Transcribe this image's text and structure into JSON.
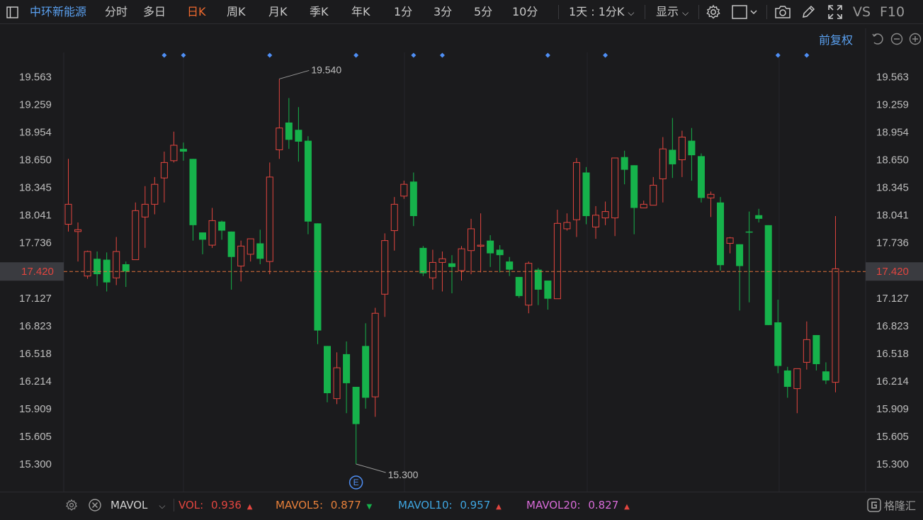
{
  "toolbar": {
    "stock_name": "中环新能源",
    "tabs": [
      "分时",
      "多日",
      "日K",
      "周K",
      "月K",
      "季K",
      "年K",
      "1分",
      "3分",
      "5分",
      "10分"
    ],
    "active_tab": "日K",
    "period_select": "1天 : 1分K",
    "display_menu": "显示",
    "vs_label": "VS",
    "f10_label": "F10"
  },
  "adjust": {
    "label": "前复权"
  },
  "axis": {
    "ticks": [
      "19.563",
      "19.259",
      "18.954",
      "18.650",
      "18.345",
      "18.041",
      "17.736",
      "17.420",
      "17.127",
      "16.823",
      "16.518",
      "16.214",
      "15.909",
      "15.605",
      "15.300"
    ],
    "current_price": "17.420"
  },
  "annotations": {
    "high": "19.540",
    "low": "15.300",
    "event_badge": "E"
  },
  "indicator": {
    "name": "MAVOL",
    "vol_label": "VOL:",
    "vol_value": "0.936",
    "mavol5_label": "MAVOL5:",
    "mavol5_value": "0.877",
    "mavol10_label": "MAVOL10:",
    "mavol10_value": "0.957",
    "mavol20_label": "MAVOL20:",
    "mavol20_value": "0.827"
  },
  "brand": {
    "name": "格隆汇"
  },
  "colors": {
    "up": "#e2453f",
    "down": "#16b24b",
    "active_tab": "#f06a2e",
    "accent_blue": "#5aa0f0",
    "marker": "#4f8ff5",
    "price_line": "#e0733a",
    "mavol20": "#d86bd8"
  },
  "chart_data": {
    "type": "candlestick",
    "y_range": [
      15.15,
      19.75
    ],
    "candles": [
      {
        "o": 17.94,
        "c": 18.16,
        "h": 18.66,
        "l": 17.86
      },
      {
        "o": 17.86,
        "c": 17.88,
        "h": 17.96,
        "l": 17.53
      },
      {
        "o": 17.37,
        "c": 17.64,
        "h": 17.65,
        "l": 17.34
      },
      {
        "o": 17.56,
        "c": 17.39,
        "h": 17.64,
        "l": 17.26
      },
      {
        "o": 17.55,
        "c": 17.3,
        "h": 17.63,
        "l": 17.2
      },
      {
        "o": 17.35,
        "c": 17.64,
        "h": 17.8,
        "l": 17.27
      },
      {
        "o": 17.5,
        "c": 17.42,
        "h": 17.53,
        "l": 17.25
      },
      {
        "o": 17.55,
        "c": 18.09,
        "h": 18.18,
        "l": 17.55
      },
      {
        "o": 18.02,
        "c": 18.16,
        "h": 18.36,
        "l": 17.68
      },
      {
        "o": 18.16,
        "c": 18.38,
        "h": 18.46,
        "l": 18.05
      },
      {
        "o": 18.45,
        "c": 18.62,
        "h": 18.74,
        "l": 18.18
      },
      {
        "o": 18.64,
        "c": 18.81,
        "h": 18.96,
        "l": 18.62
      },
      {
        "o": 18.77,
        "c": 18.74,
        "h": 18.84,
        "l": 18.64
      },
      {
        "o": 18.66,
        "c": 17.93,
        "h": 18.66,
        "l": 17.76
      },
      {
        "o": 17.85,
        "c": 17.77,
        "h": 17.85,
        "l": 17.61
      },
      {
        "o": 17.71,
        "c": 17.98,
        "h": 18.12,
        "l": 17.68
      },
      {
        "o": 17.97,
        "c": 17.87,
        "h": 17.98,
        "l": 17.77
      },
      {
        "o": 17.86,
        "c": 17.58,
        "h": 17.86,
        "l": 17.22
      },
      {
        "o": 17.48,
        "c": 17.7,
        "h": 17.76,
        "l": 17.31
      },
      {
        "o": 17.61,
        "c": 17.78,
        "h": 17.78,
        "l": 17.53
      },
      {
        "o": 17.73,
        "c": 17.56,
        "h": 17.88,
        "l": 17.5
      },
      {
        "o": 17.53,
        "c": 18.46,
        "h": 18.62,
        "l": 17.39
      },
      {
        "o": 18.76,
        "c": 19.0,
        "h": 19.54,
        "l": 18.66
      },
      {
        "o": 19.06,
        "c": 18.87,
        "h": 19.33,
        "l": 18.77
      },
      {
        "o": 18.98,
        "c": 18.85,
        "h": 19.23,
        "l": 18.63
      },
      {
        "o": 18.86,
        "c": 17.97,
        "h": 18.91,
        "l": 17.83
      },
      {
        "o": 17.95,
        "c": 16.77,
        "h": 17.95,
        "l": 16.62
      },
      {
        "o": 16.6,
        "c": 16.08,
        "h": 16.6,
        "l": 15.98
      },
      {
        "o": 16.02,
        "c": 16.36,
        "h": 16.53,
        "l": 15.96
      },
      {
        "o": 16.51,
        "c": 16.19,
        "h": 16.65,
        "l": 15.86
      },
      {
        "o": 16.15,
        "c": 15.74,
        "h": 16.15,
        "l": 15.3
      },
      {
        "o": 16.6,
        "c": 16.03,
        "h": 16.85,
        "l": 15.91
      },
      {
        "o": 16.04,
        "c": 16.96,
        "h": 17.02,
        "l": 15.82
      },
      {
        "o": 17.17,
        "c": 17.76,
        "h": 17.84,
        "l": 16.92
      },
      {
        "o": 17.87,
        "c": 18.16,
        "h": 18.24,
        "l": 17.65
      },
      {
        "o": 18.25,
        "c": 18.38,
        "h": 18.42,
        "l": 18.22
      },
      {
        "o": 18.41,
        "c": 18.03,
        "h": 18.51,
        "l": 17.92
      },
      {
        "o": 17.68,
        "c": 17.4,
        "h": 17.7,
        "l": 17.37
      },
      {
        "o": 17.35,
        "c": 17.52,
        "h": 17.66,
        "l": 17.22
      },
      {
        "o": 17.52,
        "c": 17.56,
        "h": 17.64,
        "l": 17.2
      },
      {
        "o": 17.51,
        "c": 17.47,
        "h": 17.6,
        "l": 17.18
      },
      {
        "o": 17.43,
        "c": 17.67,
        "h": 17.7,
        "l": 17.32
      },
      {
        "o": 17.65,
        "c": 17.89,
        "h": 18.0,
        "l": 17.39
      },
      {
        "o": 17.7,
        "c": 17.71,
        "h": 18.06,
        "l": 17.41
      },
      {
        "o": 17.76,
        "c": 17.62,
        "h": 17.82,
        "l": 17.47
      },
      {
        "o": 17.66,
        "c": 17.6,
        "h": 17.71,
        "l": 17.41
      },
      {
        "o": 17.53,
        "c": 17.44,
        "h": 17.58,
        "l": 17.37
      },
      {
        "o": 17.36,
        "c": 17.15,
        "h": 17.36,
        "l": 17.13
      },
      {
        "o": 17.05,
        "c": 17.51,
        "h": 17.53,
        "l": 16.96
      },
      {
        "o": 17.44,
        "c": 17.22,
        "h": 17.46,
        "l": 17.05
      },
      {
        "o": 17.32,
        "c": 17.12,
        "h": 17.32,
        "l": 17.0
      },
      {
        "o": 17.12,
        "c": 17.95,
        "h": 18.1,
        "l": 17.12
      },
      {
        "o": 17.89,
        "c": 17.96,
        "h": 18.06,
        "l": 17.87
      },
      {
        "o": 17.99,
        "c": 18.62,
        "h": 18.67,
        "l": 17.8
      },
      {
        "o": 18.51,
        "c": 18.03,
        "h": 18.57,
        "l": 17.94
      },
      {
        "o": 17.91,
        "c": 18.04,
        "h": 18.14,
        "l": 17.78
      },
      {
        "o": 18.01,
        "c": 18.08,
        "h": 18.19,
        "l": 17.93
      },
      {
        "o": 18.01,
        "c": 18.67,
        "h": 18.67,
        "l": 17.81
      },
      {
        "o": 18.68,
        "c": 18.54,
        "h": 18.75,
        "l": 18.38
      },
      {
        "o": 18.59,
        "c": 18.12,
        "h": 18.59,
        "l": 17.83
      },
      {
        "o": 18.12,
        "c": 18.16,
        "h": 18.2,
        "l": 18.12
      },
      {
        "o": 18.15,
        "c": 18.37,
        "h": 18.46,
        "l": 18.17
      },
      {
        "o": 18.44,
        "c": 18.77,
        "h": 18.9,
        "l": 18.18
      },
      {
        "o": 18.76,
        "c": 18.6,
        "h": 19.11,
        "l": 18.45
      },
      {
        "o": 18.65,
        "c": 18.9,
        "h": 18.97,
        "l": 18.46
      },
      {
        "o": 18.86,
        "c": 18.7,
        "h": 19.0,
        "l": 18.42
      },
      {
        "o": 18.69,
        "c": 18.23,
        "h": 18.72,
        "l": 18.18
      },
      {
        "o": 18.23,
        "c": 18.27,
        "h": 18.3,
        "l": 18.02
      },
      {
        "o": 18.18,
        "c": 17.49,
        "h": 18.24,
        "l": 17.43
      },
      {
        "o": 17.73,
        "c": 17.79,
        "h": 17.8,
        "l": 17.62
      },
      {
        "o": 17.72,
        "c": 17.48,
        "h": 17.72,
        "l": 16.99
      },
      {
        "o": 17.86,
        "c": 17.85,
        "h": 18.08,
        "l": 17.08
      },
      {
        "o": 18.04,
        "c": 18.0,
        "h": 18.11,
        "l": 17.96
      },
      {
        "o": 17.93,
        "c": 16.83,
        "h": 17.93,
        "l": 16.83
      },
      {
        "o": 16.86,
        "c": 16.38,
        "h": 17.11,
        "l": 16.3
      },
      {
        "o": 16.33,
        "c": 16.15,
        "h": 16.37,
        "l": 16.03
      },
      {
        "o": 16.13,
        "c": 16.35,
        "h": 16.34,
        "l": 15.86
      },
      {
        "o": 16.42,
        "c": 16.67,
        "h": 16.87,
        "l": 16.34
      },
      {
        "o": 16.72,
        "c": 16.4,
        "h": 16.72,
        "l": 16.33
      },
      {
        "o": 16.32,
        "c": 16.22,
        "h": 16.42,
        "l": 16.18
      },
      {
        "o": 16.2,
        "c": 17.45,
        "h": 18.03,
        "l": 16.09
      }
    ]
  }
}
